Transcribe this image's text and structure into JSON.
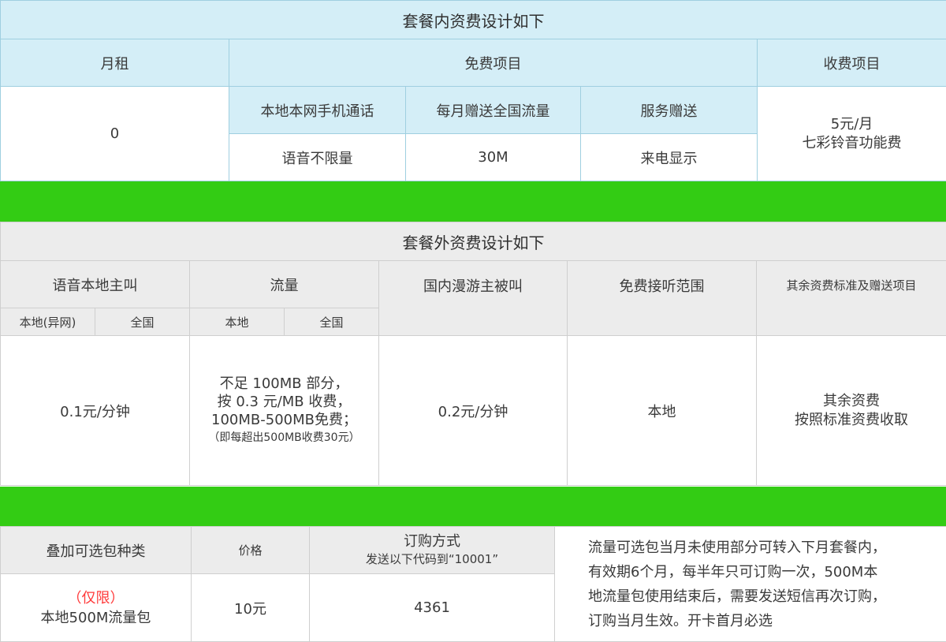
{
  "inclusive": {
    "title": "套餐内资费设计如下",
    "headers": {
      "monthly": "月租",
      "free": "免费项目",
      "charged": "收费项目"
    },
    "monthly_value": "0",
    "free_items": [
      {
        "label": "本地本网手机通话",
        "value": "语音不限量"
      },
      {
        "label": "每月赠送全国流量",
        "value": "30M"
      },
      {
        "label": "服务赠送",
        "value": "来电显示"
      }
    ],
    "charged_value": [
      "5元/月",
      "七彩铃音功能费"
    ]
  },
  "overage": {
    "title": "套餐外资费设计如下",
    "headers": {
      "voice": "语音本地主叫",
      "data": "流量",
      "roaming": "国内漫游主被叫",
      "free_receive": "免费接听范围",
      "other": "其余资费标准及赠送项目"
    },
    "sub_headers": {
      "voice_local": "本地(异网)",
      "voice_national": "全国",
      "data_local": "本地",
      "data_national": "全国"
    },
    "voice_value": "0.1元/分钟",
    "data_value": [
      "不足 100MB 部分，",
      "按 0.3 元/MB 收费，",
      "100MB-500MB免费；",
      "（即每超出500MB收费30元）"
    ],
    "roaming_value": "0.2元/分钟",
    "free_receive_value": "本地",
    "other_value": [
      "其余资费",
      "按照标准资费收取"
    ]
  },
  "addon": {
    "headers": {
      "type": "叠加可选包种类",
      "price": "价格",
      "order": "订购方式",
      "order_sub": "发送以下代码到“10001”"
    },
    "type_note": "（仅限）",
    "type_value": "本地500M流量包",
    "price_value": "10元",
    "code_value": "4361",
    "description": [
      "流量可选包当月未使用部分可转入下月套餐内，",
      "有效期6个月，每半年只可订购一次，500M本",
      "地流量包使用结束后，需要发送短信再次订购，",
      "订购当月生效。开卡首月必选"
    ]
  },
  "colors": {
    "band_green": "#33cc14",
    "header_blue": "#d4eef7",
    "header_gray": "#ececec",
    "note_red": "#ff3a3a"
  }
}
